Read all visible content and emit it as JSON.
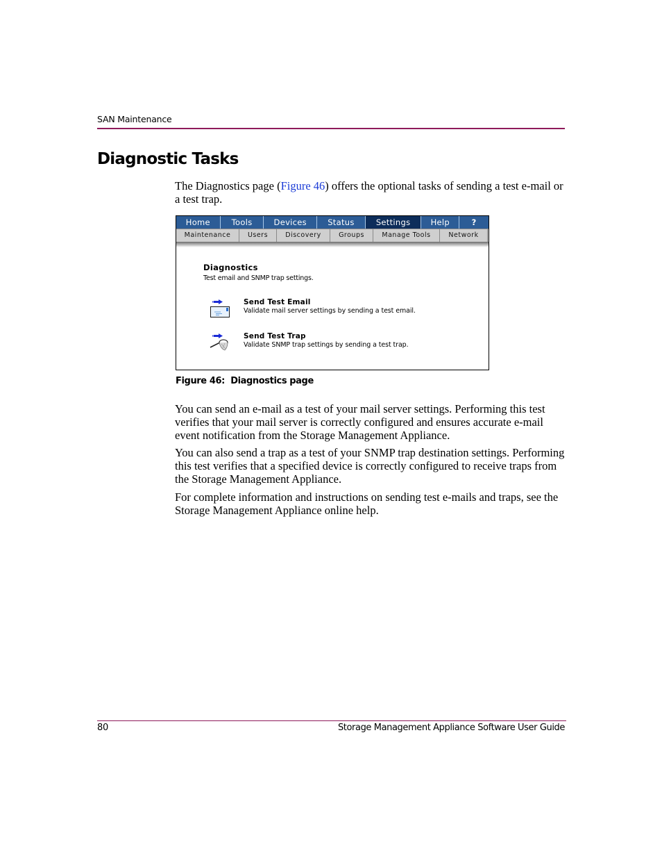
{
  "header": {
    "running_title": "SAN Maintenance",
    "rule_color": "#8e1a5a"
  },
  "section": {
    "title": "Diagnostic Tasks"
  },
  "intro": {
    "before_link": "The Diagnostics page (",
    "link_text": "Figure 46",
    "after_link": ") offers the optional tasks of sending a test e-mail or a test trap."
  },
  "figure": {
    "top_nav": [
      {
        "label": "Home",
        "active": false
      },
      {
        "label": "Tools",
        "active": false
      },
      {
        "label": "Devices",
        "active": false
      },
      {
        "label": "Status",
        "active": false
      },
      {
        "label": "Settings",
        "active": true
      },
      {
        "label": "Help",
        "active": false
      },
      {
        "label": "?",
        "active": false
      }
    ],
    "sub_nav": [
      {
        "label": "Maintenance"
      },
      {
        "label": "Users"
      },
      {
        "label": "Discovery"
      },
      {
        "label": "Groups"
      },
      {
        "label": "Manage Tools"
      },
      {
        "label": "Network"
      }
    ],
    "page_title": "Diagnostics",
    "page_subtitle": "Test email and SNMP trap settings.",
    "tasks": [
      {
        "icon": "send-email-icon",
        "label": "Send Test Email",
        "description": "Validate mail server settings by sending a test email."
      },
      {
        "icon": "send-trap-icon",
        "label": "Send Test Trap",
        "description": "Validate SNMP trap settings by sending a test trap."
      }
    ],
    "colors": {
      "nav_bg": "#2c5c96",
      "nav_active": "#0d2d5a",
      "subnav_bg": "#cfcfcf"
    },
    "caption": "Figure 46:  Diagnostics page"
  },
  "body": {
    "paragraphs": [
      "You can send an e-mail as a test of your mail server settings. Performing this test verifies that your mail server is correctly configured and ensures accurate e-mail event notification from the Storage Management Appliance.",
      "You can also send a trap as a test of your SNMP trap destination settings. Performing this test verifies that a specified device is correctly configured to receive traps from the Storage Management Appliance.",
      "For complete information and instructions on sending test e-mails and traps, see the Storage Management Appliance online help."
    ]
  },
  "footer": {
    "page_number": "80",
    "document_title": "Storage Management Appliance Software User Guide"
  }
}
